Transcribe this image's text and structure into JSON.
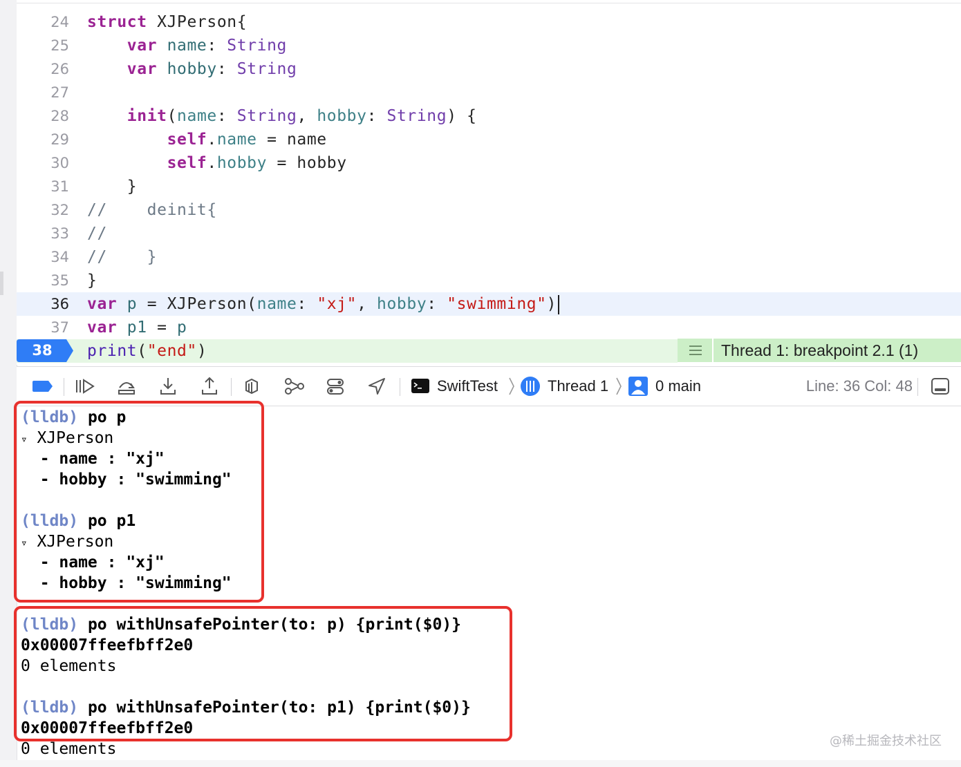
{
  "editor": {
    "lines": [
      {
        "num": "24",
        "parts": [
          [
            "kw",
            "struct"
          ],
          [
            "",
            " XJPerson{"
          ]
        ]
      },
      {
        "num": "25",
        "parts": [
          [
            "",
            "    "
          ],
          [
            "kw",
            "var"
          ],
          [
            "",
            " "
          ],
          [
            "pr",
            "name"
          ],
          [
            "",
            ": "
          ],
          [
            "ty",
            "String"
          ]
        ]
      },
      {
        "num": "26",
        "parts": [
          [
            "",
            "    "
          ],
          [
            "kw",
            "var"
          ],
          [
            "",
            " "
          ],
          [
            "pr",
            "hobby"
          ],
          [
            "",
            ": "
          ],
          [
            "ty",
            "String"
          ]
        ]
      },
      {
        "num": "27",
        "parts": []
      },
      {
        "num": "28",
        "parts": [
          [
            "",
            "    "
          ],
          [
            "kw",
            "init"
          ],
          [
            "",
            "("
          ],
          [
            "pr2",
            "name"
          ],
          [
            "",
            ": "
          ],
          [
            "ty",
            "String"
          ],
          [
            "",
            ", "
          ],
          [
            "pr2",
            "hobby"
          ],
          [
            "",
            ": "
          ],
          [
            "ty",
            "String"
          ],
          [
            "",
            ") {"
          ]
        ]
      },
      {
        "num": "29",
        "parts": [
          [
            "",
            "        "
          ],
          [
            "kw",
            "self"
          ],
          [
            "",
            "."
          ],
          [
            "pr2",
            "name"
          ],
          [
            "",
            " = name"
          ]
        ]
      },
      {
        "num": "30",
        "parts": [
          [
            "",
            "        "
          ],
          [
            "kw",
            "self"
          ],
          [
            "",
            "."
          ],
          [
            "pr2",
            "hobby"
          ],
          [
            "",
            " = hobby"
          ]
        ]
      },
      {
        "num": "31",
        "parts": [
          [
            "",
            "    }"
          ]
        ]
      },
      {
        "num": "32",
        "parts": [
          [
            "cm",
            "//    deinit{"
          ]
        ]
      },
      {
        "num": "33",
        "parts": [
          [
            "cm",
            "//"
          ]
        ]
      },
      {
        "num": "34",
        "parts": [
          [
            "cm",
            "//    }"
          ]
        ]
      },
      {
        "num": "35",
        "parts": [
          [
            "",
            "}"
          ]
        ]
      },
      {
        "num": "36",
        "parts": [
          [
            "kw",
            "var"
          ],
          [
            "",
            " "
          ],
          [
            "pr",
            "p"
          ],
          [
            "",
            " = XJPerson("
          ],
          [
            "pr2",
            "name"
          ],
          [
            "",
            ": "
          ],
          [
            "st",
            "\"xj\""
          ],
          [
            "",
            ", "
          ],
          [
            "pr2",
            "hobby"
          ],
          [
            "",
            ": "
          ],
          [
            "st",
            "\"swimming\""
          ],
          [
            "",
            ")"
          ]
        ]
      },
      {
        "num": "37",
        "parts": [
          [
            "kw",
            "var"
          ],
          [
            "",
            " "
          ],
          [
            "pr",
            "p1"
          ],
          [
            "",
            " = "
          ],
          [
            "pr",
            "p"
          ]
        ]
      },
      {
        "num": "38",
        "parts": [
          [
            "fn",
            "print"
          ],
          [
            "",
            "("
          ],
          [
            "st",
            "\"end\""
          ],
          [
            "",
            ")"
          ]
        ]
      }
    ],
    "current_line": "36",
    "breakpoint_line": "38",
    "breakpoint_label": "Thread 1: breakpoint 2.1 (1)"
  },
  "debugbar": {
    "target": "SwiftTest",
    "thread": "Thread 1",
    "frame": "0 main",
    "line_col": "Line: 36  Col: 48",
    "icons": [
      "breakpoints-toggle-icon",
      "continue-icon",
      "step-over-icon",
      "step-into-icon",
      "step-out-icon",
      "view-hierarchy-icon",
      "memory-graph-icon",
      "environment-overrides-icon",
      "simulate-location-icon",
      "terminal-icon",
      "thread-icon",
      "frame-icon",
      "split-console-icon"
    ]
  },
  "console": {
    "lines": [
      {
        "prompt": "(lldb)",
        "text": " po p"
      },
      {
        "tri": "▿",
        "text": " XJPerson"
      },
      {
        "text": "  - name : \"xj\""
      },
      {
        "text": "  - hobby : \"swimming\""
      },
      {
        "text": ""
      },
      {
        "prompt": "(lldb)",
        "text": " po p1"
      },
      {
        "tri": "▿",
        "text": " XJPerson"
      },
      {
        "text": "  - name : \"xj\""
      },
      {
        "text": "  - hobby : \"swimming\""
      },
      {
        "text": ""
      },
      {
        "prompt": "(lldb)",
        "text": " po withUnsafePointer(to: p) {print($0)}"
      },
      {
        "text": "0x00007ffeefbff2e0"
      },
      {
        "text": "0 elements"
      },
      {
        "text": ""
      },
      {
        "prompt": "(lldb)",
        "text": " po withUnsafePointer(to: p1) {print($0)}"
      },
      {
        "text": "0x00007ffeefbff2e0"
      },
      {
        "text": "0 elements"
      }
    ]
  },
  "watermark": "@稀土掘金技术社区",
  "colors": {
    "highlight_box": "#e8312d",
    "breakpoint": "#2f7df6",
    "lldb_prompt": "#6f86c7"
  }
}
